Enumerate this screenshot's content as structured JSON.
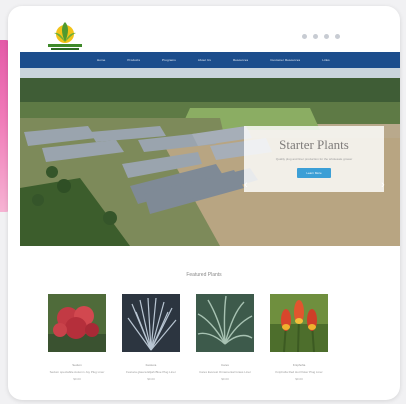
{
  "nav": {
    "items": [
      "Home",
      "Products",
      "Programs",
      "About Us",
      "Resources",
      "Customer Resources",
      "Links"
    ]
  },
  "hero": {
    "title": "Starter Plants",
    "subtitle": "Quality plug and liner production for the wholesale grower",
    "button_label": "Learn More",
    "prev_icon": "chevron-left-icon",
    "next_icon": "chevron-right-icon"
  },
  "featured": {
    "title": "Featured Plants",
    "products": [
      {
        "name": "Sedum",
        "desc": "Sedum spectabile Autumn Joy Plug Liner",
        "price": "$0.00",
        "image": "red-sedum-flowers"
      },
      {
        "name": "Festuca",
        "desc": "Festuca glauca Elijah Blue Plug Liner",
        "price": "$0.00",
        "image": "blue-grass-plant"
      },
      {
        "name": "Carex",
        "desc": "Carex Everest Ornamental Grass Liner",
        "price": "$0.00",
        "image": "green-grass-plant"
      },
      {
        "name": "Kniphofia",
        "desc": "Kniphofia Red Hot Poker Plug Liner",
        "price": "$0.00",
        "image": "red-hot-poker-flowers"
      }
    ]
  },
  "colors": {
    "nav": "#1c4d8c",
    "button": "#3c9fd6",
    "accent_pink": "#e45aa8"
  }
}
